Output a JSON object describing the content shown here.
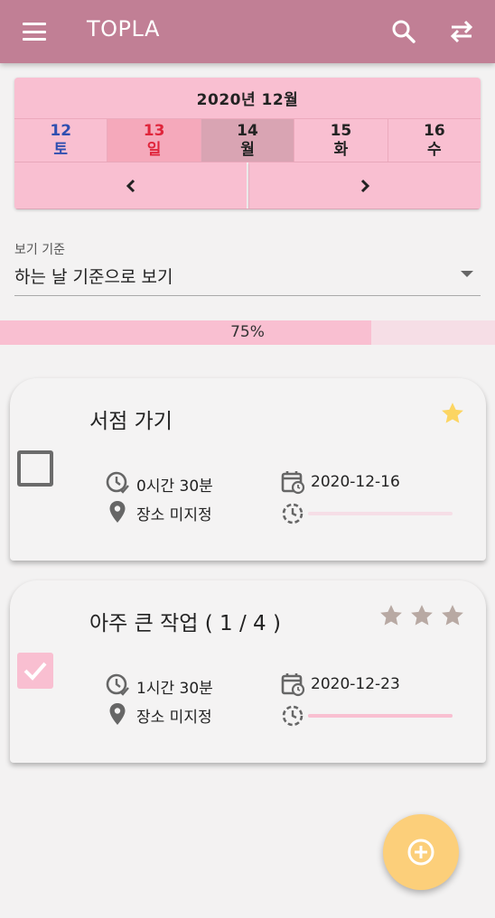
{
  "appbar": {
    "title": "TOPLA",
    "menu_icon": "menu-icon",
    "search_icon": "search-icon",
    "swap_icon": "swap-icon",
    "color": "#c17f95"
  },
  "calendar": {
    "month": "2020년 12월",
    "days": [
      {
        "num": "12",
        "weekday": "토",
        "kind": "sat"
      },
      {
        "num": "13",
        "weekday": "일",
        "kind": "sun"
      },
      {
        "num": "14",
        "weekday": "월",
        "kind": "selected"
      },
      {
        "num": "15",
        "weekday": "화",
        "kind": "normal"
      },
      {
        "num": "16",
        "weekday": "수",
        "kind": "normal"
      }
    ],
    "prev_icon": "chevron-left-icon",
    "next_icon": "chevron-right-icon",
    "accent": "#f9bfd1"
  },
  "view_select": {
    "label": "보기 기준",
    "value": "하는 날 기준으로 보기"
  },
  "progress": {
    "percent": 75,
    "label": "75%"
  },
  "tasks": [
    {
      "title": "서점 가기",
      "checked": false,
      "stars": [
        {
          "filled": true
        }
      ],
      "duration": "0시간 30분",
      "date": "2020-12-16",
      "place": "장소 미지정",
      "progress": 0
    },
    {
      "title": "아주 큰 작업 ( 1 / 4 )",
      "checked": true,
      "stars": [
        {
          "filled": false
        },
        {
          "filled": false
        },
        {
          "filled": false
        }
      ],
      "duration": "1시간 30분",
      "date": "2020-12-23",
      "place": "장소 미지정",
      "progress": 1
    }
  ],
  "fab": {
    "icon": "add-circle-icon",
    "color": "#fccf7a"
  }
}
